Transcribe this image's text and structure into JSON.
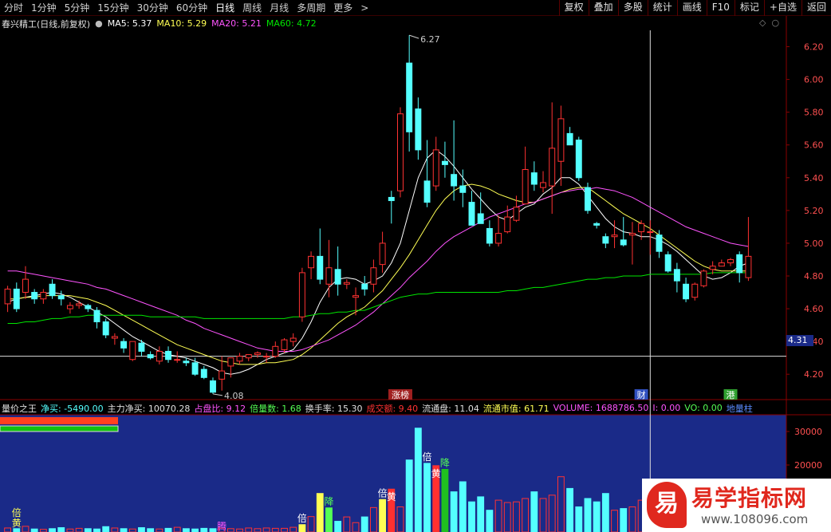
{
  "toolbar": {
    "periods": [
      "分时",
      "1分钟",
      "5分钟",
      "15分钟",
      "30分钟",
      "60分钟",
      "日线",
      "周线",
      "月线",
      "多周期",
      "更多"
    ],
    "active_period": "日线",
    "more_arrow": ">",
    "actions": [
      "复权",
      "叠加",
      "多股",
      "统计",
      "画线",
      "F10",
      "标记",
      "+自选",
      "返回"
    ]
  },
  "info": {
    "stock": "春兴精工(日线,前复权)",
    "ma5": "MA5: 5.37",
    "ma10": "MA10: 5.29",
    "ma20": "MA20: 5.21",
    "ma60": "MA60: 4.72"
  },
  "icons": {
    "settings": "circle-icon",
    "diamond": "diamond-icon"
  },
  "colors": {
    "up": "#ff3232",
    "down": "#54ffff",
    "ma5": "#ffffff",
    "ma10": "#ffff54",
    "ma20": "#ff54ff",
    "ma60": "#00e600",
    "axis_text": "#ff5050",
    "grid": "#3a0000",
    "vol_bg": "#1a2a88"
  },
  "indicator": {
    "name": "量价之王",
    "net_buy": "净买: -5490.00",
    "main_net_buy": "主力净买: 10070.28",
    "share_ratio": "占盘比: 9.12",
    "vol_multiple": "倍量数: 1.68",
    "turnover": "换手率: 15.30",
    "amount": "成交额: 9.40",
    "float_shares": "流通盘: 11.04",
    "float_mv": "流通市值: 61.71",
    "volume": "VOLUME: 1688786.50",
    "i": "I: 0.00",
    "vo": "VO: 0.00",
    "ground": "地量柱"
  },
  "chart_data": [
    {
      "type": "candlestick",
      "title": "春兴精工(日线,前复权)",
      "ylim": [
        4.05,
        6.3
      ],
      "y_ticks": [
        "6.20",
        "6.00",
        "5.80",
        "5.60",
        "5.40",
        "5.20",
        "5.00",
        "4.80",
        "4.60",
        "4.40",
        "4.20"
      ],
      "current_price": "4.31",
      "annotations": {
        "high": "6.27",
        "low": "4.08"
      },
      "event_markers": [
        "涨榜",
        "财",
        "港"
      ],
      "candles": [
        {
          "o": 4.63,
          "h": 4.74,
          "l": 4.58,
          "c": 4.72
        },
        {
          "o": 4.72,
          "h": 4.76,
          "l": 4.58,
          "c": 4.6
        },
        {
          "o": 4.7,
          "h": 4.86,
          "l": 4.66,
          "c": 4.78
        },
        {
          "o": 4.7,
          "h": 4.72,
          "l": 4.63,
          "c": 4.66
        },
        {
          "o": 4.66,
          "h": 4.72,
          "l": 4.63,
          "c": 4.7
        },
        {
          "o": 4.75,
          "h": 4.78,
          "l": 4.66,
          "c": 4.68
        },
        {
          "o": 4.68,
          "h": 4.71,
          "l": 4.62,
          "c": 4.66
        },
        {
          "o": 4.6,
          "h": 4.64,
          "l": 4.57,
          "c": 4.62
        },
        {
          "o": 4.62,
          "h": 4.65,
          "l": 4.6,
          "c": 4.63
        },
        {
          "o": 4.62,
          "h": 4.63,
          "l": 4.58,
          "c": 4.6
        },
        {
          "o": 4.59,
          "h": 4.61,
          "l": 4.48,
          "c": 4.52
        },
        {
          "o": 4.52,
          "h": 4.54,
          "l": 4.42,
          "c": 4.44
        },
        {
          "o": 4.42,
          "h": 4.45,
          "l": 4.38,
          "c": 4.43
        },
        {
          "o": 4.4,
          "h": 4.42,
          "l": 4.33,
          "c": 4.36
        },
        {
          "o": 4.29,
          "h": 4.4,
          "l": 4.28,
          "c": 4.4
        },
        {
          "o": 4.39,
          "h": 4.41,
          "l": 4.31,
          "c": 4.34
        },
        {
          "o": 4.32,
          "h": 4.34,
          "l": 4.29,
          "c": 4.3
        },
        {
          "o": 4.28,
          "h": 4.37,
          "l": 4.26,
          "c": 4.34
        },
        {
          "o": 4.34,
          "h": 4.37,
          "l": 4.27,
          "c": 4.29
        },
        {
          "o": 4.29,
          "h": 4.34,
          "l": 4.27,
          "c": 4.29
        },
        {
          "o": 4.28,
          "h": 4.3,
          "l": 4.25,
          "c": 4.27
        },
        {
          "o": 4.27,
          "h": 4.3,
          "l": 4.19,
          "c": 4.2
        },
        {
          "o": 4.23,
          "h": 4.25,
          "l": 4.17,
          "c": 4.18
        },
        {
          "o": 4.16,
          "h": 4.18,
          "l": 4.08,
          "c": 4.09
        },
        {
          "o": 4.17,
          "h": 4.31,
          "l": 4.1,
          "c": 4.22
        },
        {
          "o": 4.25,
          "h": 4.3,
          "l": 4.18,
          "c": 4.3
        },
        {
          "o": 4.28,
          "h": 4.33,
          "l": 4.26,
          "c": 4.31
        },
        {
          "o": 4.3,
          "h": 4.32,
          "l": 4.28,
          "c": 4.32
        },
        {
          "o": 4.32,
          "h": 4.34,
          "l": 4.3,
          "c": 4.33
        },
        {
          "o": 4.31,
          "h": 4.33,
          "l": 4.27,
          "c": 4.31
        },
        {
          "o": 4.31,
          "h": 4.4,
          "l": 4.3,
          "c": 4.37
        },
        {
          "o": 4.35,
          "h": 4.42,
          "l": 4.33,
          "c": 4.41
        },
        {
          "o": 4.4,
          "h": 4.45,
          "l": 4.37,
          "c": 4.42
        },
        {
          "o": 4.55,
          "h": 4.85,
          "l": 4.52,
          "c": 4.82
        },
        {
          "o": 4.85,
          "h": 4.95,
          "l": 4.78,
          "c": 4.92
        },
        {
          "o": 4.92,
          "h": 5.09,
          "l": 4.75,
          "c": 4.78
        },
        {
          "o": 4.75,
          "h": 5.02,
          "l": 4.67,
          "c": 4.85
        },
        {
          "o": 4.84,
          "h": 4.98,
          "l": 4.68,
          "c": 4.75
        },
        {
          "o": 4.75,
          "h": 4.78,
          "l": 4.72,
          "c": 4.76
        },
        {
          "o": 4.67,
          "h": 4.73,
          "l": 4.56,
          "c": 4.68
        },
        {
          "o": 4.75,
          "h": 4.8,
          "l": 4.68,
          "c": 4.72
        },
        {
          "o": 4.75,
          "h": 4.9,
          "l": 4.7,
          "c": 4.85
        },
        {
          "o": 4.87,
          "h": 5.07,
          "l": 4.82,
          "c": 5.0
        },
        {
          "o": 5.28,
          "h": 5.32,
          "l": 5.12,
          "c": 5.26
        },
        {
          "o": 5.32,
          "h": 5.83,
          "l": 5.28,
          "c": 5.79
        },
        {
          "o": 6.1,
          "h": 6.27,
          "l": 5.56,
          "c": 5.68
        },
        {
          "o": 5.82,
          "h": 5.89,
          "l": 5.51,
          "c": 5.57
        },
        {
          "o": 5.38,
          "h": 5.63,
          "l": 5.22,
          "c": 5.25
        },
        {
          "o": 5.35,
          "h": 5.65,
          "l": 5.32,
          "c": 5.57
        },
        {
          "o": 5.5,
          "h": 5.62,
          "l": 5.4,
          "c": 5.48
        },
        {
          "o": 5.42,
          "h": 5.75,
          "l": 5.26,
          "c": 5.35
        },
        {
          "o": 5.35,
          "h": 5.45,
          "l": 5.22,
          "c": 5.31
        },
        {
          "o": 5.25,
          "h": 5.32,
          "l": 5.11,
          "c": 5.11
        },
        {
          "o": 5.18,
          "h": 5.31,
          "l": 5.13,
          "c": 5.12
        },
        {
          "o": 5.09,
          "h": 5.14,
          "l": 4.98,
          "c": 5.0
        },
        {
          "o": 5.0,
          "h": 5.17,
          "l": 4.98,
          "c": 5.06
        },
        {
          "o": 5.07,
          "h": 5.23,
          "l": 5.06,
          "c": 5.16
        },
        {
          "o": 5.14,
          "h": 5.29,
          "l": 5.13,
          "c": 5.22
        },
        {
          "o": 5.24,
          "h": 5.59,
          "l": 5.24,
          "c": 5.45
        },
        {
          "o": 5.43,
          "h": 5.5,
          "l": 5.32,
          "c": 5.36
        },
        {
          "o": 5.34,
          "h": 5.44,
          "l": 5.31,
          "c": 5.37
        },
        {
          "o": 5.35,
          "h": 5.86,
          "l": 5.18,
          "c": 5.58
        },
        {
          "o": 5.5,
          "h": 5.84,
          "l": 5.35,
          "c": 5.76
        },
        {
          "o": 5.67,
          "h": 5.71,
          "l": 5.62,
          "c": 5.6
        },
        {
          "o": 5.63,
          "h": 5.65,
          "l": 5.38,
          "c": 5.4
        },
        {
          "o": 5.34,
          "h": 5.37,
          "l": 5.18,
          "c": 5.2
        },
        {
          "o": 5.12,
          "h": 5.13,
          "l": 5.09,
          "c": 5.11
        },
        {
          "o": 5.04,
          "h": 5.06,
          "l": 4.97,
          "c": 5.0
        },
        {
          "o": 5.04,
          "h": 5.14,
          "l": 4.97,
          "c": 5.05
        },
        {
          "o": 5.02,
          "h": 5.16,
          "l": 4.98,
          "c": 4.99
        },
        {
          "o": 5.05,
          "h": 5.13,
          "l": 4.87,
          "c": 5.06
        },
        {
          "o": 5.07,
          "h": 5.14,
          "l": 5.02,
          "c": 5.12
        },
        {
          "o": 5.07,
          "h": 5.14,
          "l": 4.93,
          "c": 5.07
        },
        {
          "o": 5.05,
          "h": 5.08,
          "l": 4.91,
          "c": 4.95
        },
        {
          "o": 4.93,
          "h": 4.95,
          "l": 4.82,
          "c": 4.83
        },
        {
          "o": 4.84,
          "h": 4.88,
          "l": 4.7,
          "c": 4.77
        },
        {
          "o": 4.75,
          "h": 4.79,
          "l": 4.64,
          "c": 4.66
        },
        {
          "o": 4.67,
          "h": 4.76,
          "l": 4.65,
          "c": 4.75
        },
        {
          "o": 4.74,
          "h": 4.84,
          "l": 4.73,
          "c": 4.83
        },
        {
          "o": 4.84,
          "h": 4.89,
          "l": 4.81,
          "c": 4.86
        },
        {
          "o": 4.86,
          "h": 4.9,
          "l": 4.86,
          "c": 4.88
        },
        {
          "o": 4.88,
          "h": 4.91,
          "l": 4.86,
          "c": 4.9
        },
        {
          "o": 4.93,
          "h": 4.95,
          "l": 4.76,
          "c": 4.82
        },
        {
          "o": 4.79,
          "h": 5.16,
          "l": 4.77,
          "c": 4.92
        }
      ],
      "series": [
        {
          "name": "MA5",
          "values": [
            4.64,
            4.66,
            4.67,
            4.68,
            4.69,
            4.7,
            4.69,
            4.67,
            4.64,
            4.61,
            4.58,
            4.55,
            4.51,
            4.47,
            4.43,
            4.4,
            4.37,
            4.34,
            4.32,
            4.31,
            4.3,
            4.28,
            4.26,
            4.24,
            4.21,
            4.2,
            4.21,
            4.23,
            4.26,
            4.29,
            4.31,
            4.33,
            4.35,
            4.42,
            4.52,
            4.64,
            4.73,
            4.78,
            4.79,
            4.78,
            4.75,
            4.77,
            4.8,
            4.88,
            5.0,
            5.2,
            5.4,
            5.52,
            5.57,
            5.53,
            5.47,
            5.4,
            5.33,
            5.27,
            5.21,
            5.16,
            5.14,
            5.18,
            5.22,
            5.24,
            5.3,
            5.34,
            5.4,
            5.4,
            5.36,
            5.29,
            5.22,
            5.15,
            5.1,
            5.07,
            5.06,
            5.04,
            5.04,
            5.02,
            4.99,
            4.95,
            4.9,
            4.85,
            4.8,
            4.78,
            4.79,
            4.82,
            4.86,
            4.88
          ]
        },
        {
          "name": "MA10",
          "values": [
            4.66,
            4.66,
            4.67,
            4.67,
            4.68,
            4.68,
            4.68,
            4.68,
            4.67,
            4.66,
            4.64,
            4.62,
            4.59,
            4.56,
            4.53,
            4.5,
            4.47,
            4.44,
            4.41,
            4.38,
            4.36,
            4.34,
            4.32,
            4.3,
            4.28,
            4.27,
            4.26,
            4.26,
            4.26,
            4.27,
            4.27,
            4.28,
            4.29,
            4.32,
            4.36,
            4.41,
            4.46,
            4.51,
            4.55,
            4.58,
            4.61,
            4.66,
            4.71,
            4.78,
            4.85,
            4.93,
            5.02,
            5.11,
            5.2,
            5.27,
            5.32,
            5.35,
            5.36,
            5.35,
            5.33,
            5.3,
            5.28,
            5.26,
            5.25,
            5.25,
            5.27,
            5.29,
            5.31,
            5.33,
            5.34,
            5.34,
            5.3,
            5.26,
            5.22,
            5.18,
            5.15,
            5.12,
            5.09,
            5.05,
            5.01,
            4.97,
            4.93,
            4.89,
            4.86,
            4.84,
            4.83,
            4.83,
            4.83,
            4.83
          ]
        },
        {
          "name": "MA20",
          "values": [
            4.83,
            4.83,
            4.82,
            4.81,
            4.8,
            4.79,
            4.78,
            4.77,
            4.76,
            4.75,
            4.73,
            4.72,
            4.7,
            4.68,
            4.66,
            4.64,
            4.62,
            4.6,
            4.58,
            4.56,
            4.53,
            4.51,
            4.48,
            4.46,
            4.44,
            4.42,
            4.4,
            4.38,
            4.36,
            4.35,
            4.34,
            4.34,
            4.34,
            4.35,
            4.37,
            4.39,
            4.41,
            4.44,
            4.47,
            4.5,
            4.54,
            4.58,
            4.63,
            4.68,
            4.73,
            4.79,
            4.84,
            4.89,
            4.95,
            5.0,
            5.04,
            5.07,
            5.1,
            5.13,
            5.16,
            5.18,
            5.2,
            5.22,
            5.24,
            5.25,
            5.27,
            5.29,
            5.31,
            5.32,
            5.33,
            5.33,
            5.34,
            5.33,
            5.32,
            5.3,
            5.28,
            5.25,
            5.22,
            5.19,
            5.16,
            5.13,
            5.1,
            5.08,
            5.06,
            5.04,
            5.02,
            5.0,
            4.99,
            4.98
          ]
        },
        {
          "name": "MA60",
          "values": [
            4.51,
            4.51,
            4.52,
            4.52,
            4.53,
            4.54,
            4.54,
            4.55,
            4.55,
            4.56,
            4.56,
            4.56,
            4.56,
            4.56,
            4.56,
            4.56,
            4.55,
            4.55,
            4.55,
            4.55,
            4.55,
            4.55,
            4.54,
            4.54,
            4.54,
            4.54,
            4.54,
            4.54,
            4.54,
            4.54,
            4.54,
            4.54,
            4.55,
            4.55,
            4.56,
            4.57,
            4.57,
            4.58,
            4.58,
            4.59,
            4.59,
            4.61,
            4.63,
            4.65,
            4.67,
            4.68,
            4.69,
            4.69,
            4.7,
            4.7,
            4.7,
            4.7,
            4.7,
            4.7,
            4.7,
            4.7,
            4.71,
            4.71,
            4.72,
            4.73,
            4.73,
            4.74,
            4.75,
            4.76,
            4.77,
            4.78,
            4.78,
            4.79,
            4.79,
            4.8,
            4.8,
            4.8,
            4.81,
            4.81,
            4.81,
            4.81,
            4.81,
            4.81,
            4.81,
            4.82,
            4.82,
            4.82,
            4.82,
            4.82
          ]
        }
      ]
    },
    {
      "type": "bar",
      "title": "量价之王",
      "ylim": [
        0,
        35000
      ],
      "y_ticks": [
        "30000",
        "20000"
      ],
      "badges": {
        "double": "倍",
        "yellow": "黄",
        "decline": "降",
        "up": "腾"
      },
      "values": [
        1200,
        1000,
        1700,
        900,
        800,
        1000,
        1300,
        900,
        1100,
        1000,
        900,
        1600,
        1200,
        1000,
        900,
        1300,
        1000,
        900,
        1100,
        1400,
        1000,
        900,
        1100,
        1000,
        1200,
        1000,
        900,
        1200,
        1000,
        1200,
        1100,
        1100,
        1400,
        2200,
        4600,
        11500,
        7200,
        3200,
        4500,
        2800,
        4500,
        7300,
        9700,
        12800,
        7500,
        21500,
        31000,
        20500,
        19800,
        18700,
        12000,
        15000,
        9000,
        10500,
        6500,
        9500,
        8800,
        9000,
        10000,
        12000,
        10000,
        11000,
        16500,
        13000,
        7500,
        10000,
        9000,
        11500,
        6500,
        7000,
        7500,
        9500,
        8000,
        11000,
        8000,
        5200,
        4000,
        4500,
        3000,
        3500,
        4000,
        3000,
        2500,
        6500
      ]
    }
  ],
  "watermark": {
    "logo_char": "易",
    "title": "易学指标网",
    "url": "www.108096.com"
  }
}
